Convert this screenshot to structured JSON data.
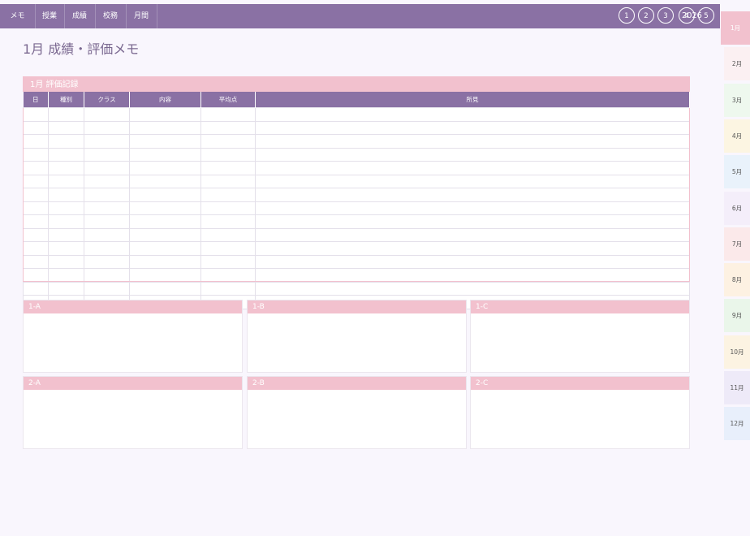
{
  "nav": {
    "tabs": [
      "メモ",
      "授業",
      "成績",
      "校務",
      "月間"
    ],
    "circles": [
      "1",
      "2",
      "3",
      "4",
      "5"
    ],
    "year": "2026"
  },
  "page": {
    "title": "1月 成績・評価メモ"
  },
  "record": {
    "header": "1月 評価記録",
    "columns": [
      "日",
      "種別",
      "クラス",
      "内容",
      "平均点",
      "所見"
    ]
  },
  "classes": [
    "1-A",
    "1-B",
    "1-C",
    "2-A",
    "2-B",
    "2-C"
  ],
  "months": [
    "1月",
    "2月",
    "3月",
    "4月",
    "5月",
    "6月",
    "7月",
    "8月",
    "9月",
    "10月",
    "11月",
    "12月"
  ],
  "active_month": "1月",
  "colors": {
    "nav_purple": "#8a71a4",
    "accent_pink": "#f2c1ce",
    "month_tab_colors": [
      "#f2c1ce",
      "#fbf0f2",
      "#eef8ee",
      "#fcf5e2",
      "#e9f2fb",
      "#f4eefa",
      "#fbe9ea",
      "#fdf1e2",
      "#eaf6ea",
      "#fcf3e2",
      "#eeeaf8",
      "#e8effb"
    ]
  }
}
